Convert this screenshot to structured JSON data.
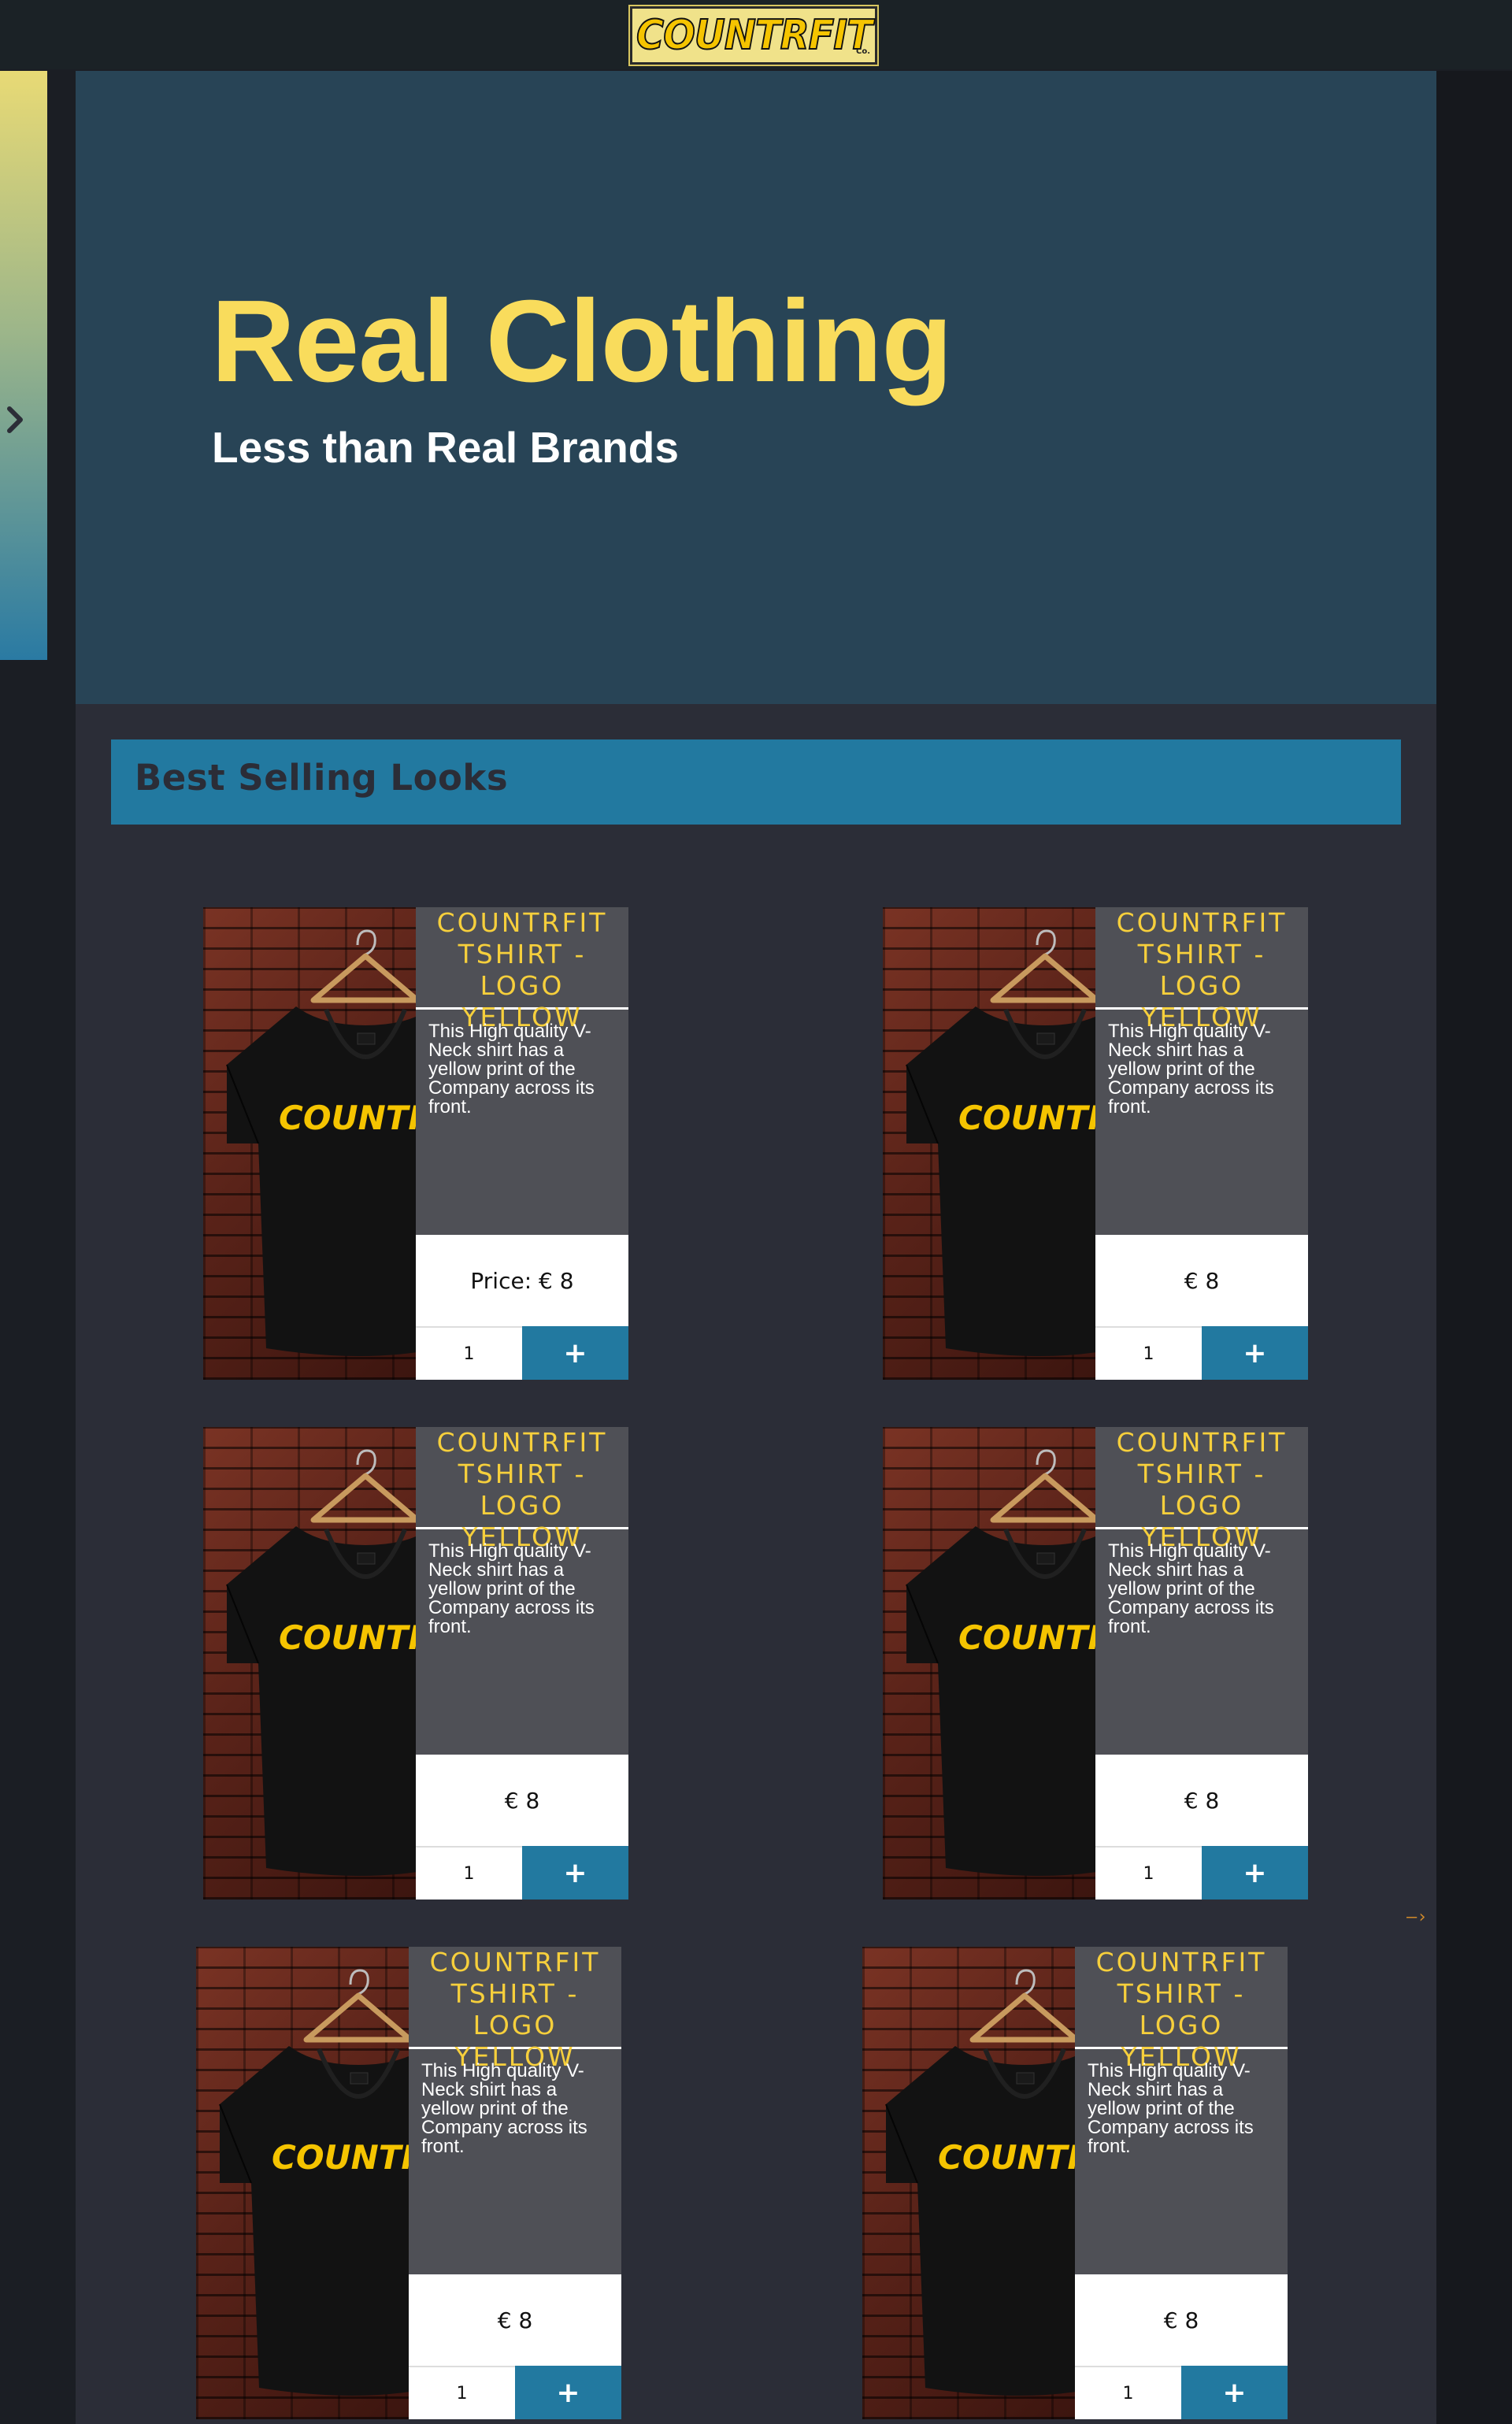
{
  "header": {
    "logo_text": "COUNTRFIT",
    "logo_suffix": "Co."
  },
  "sidebar": {
    "toggle_icon": "chevron-right-icon"
  },
  "hero": {
    "title": "Real Clothing",
    "subtitle": "Less than Real Brands"
  },
  "section": {
    "title": "Best Selling Looks"
  },
  "products": [
    {
      "title": "COUNTRFIT TSHIRT - LOGO YELLOW",
      "description": "This High quality V-Neck shirt has a yellow print of the Company across its front.",
      "price": "Price: € 8",
      "quantity": "1",
      "add_label": "+",
      "shirt_print": "COUNTRFIT"
    },
    {
      "title": "COUNTRFIT TSHIRT - LOGO YELLOW",
      "description": "This High quality V-Neck shirt has a yellow print of the Company across its front.",
      "price": "€ 8",
      "quantity": "1",
      "add_label": "+",
      "shirt_print": "COUNTRFIT"
    },
    {
      "title": "COUNTRFIT TSHIRT - LOGO YELLOW",
      "description": "This High quality V-Neck shirt has a yellow print of the Company across its front.",
      "price": "€ 8",
      "quantity": "1",
      "add_label": "+",
      "shirt_print": "COUNTRFIT"
    },
    {
      "title": "COUNTRFIT TSHIRT - LOGO YELLOW",
      "description": "This High quality V-Neck shirt has a yellow print of the Company across its front.",
      "price": "€ 8",
      "quantity": "1",
      "add_label": "+",
      "shirt_print": "COUNTRFIT"
    },
    {
      "title": "COUNTRFIT TSHIRT - LOGO YELLOW",
      "description": "This High quality V-Neck shirt has a yellow print of the Company across its front.",
      "price": "€ 8",
      "quantity": "1",
      "add_label": "+",
      "shirt_print": "COUNTRFIT"
    },
    {
      "title": "COUNTRFIT TSHIRT - LOGO YELLOW",
      "description": "This High quality V-Neck shirt has a yellow print of the Company across its front.",
      "price": "€ 8",
      "quantity": "1",
      "add_label": "+",
      "shirt_print": "COUNTRFIT"
    }
  ],
  "pager": {
    "next_label": "—›"
  },
  "colors": {
    "accent_yellow": "#f9dc5c",
    "accent_blue": "#2279a0",
    "hero_bg": "#284456",
    "page_bg": "#2b2d37"
  }
}
